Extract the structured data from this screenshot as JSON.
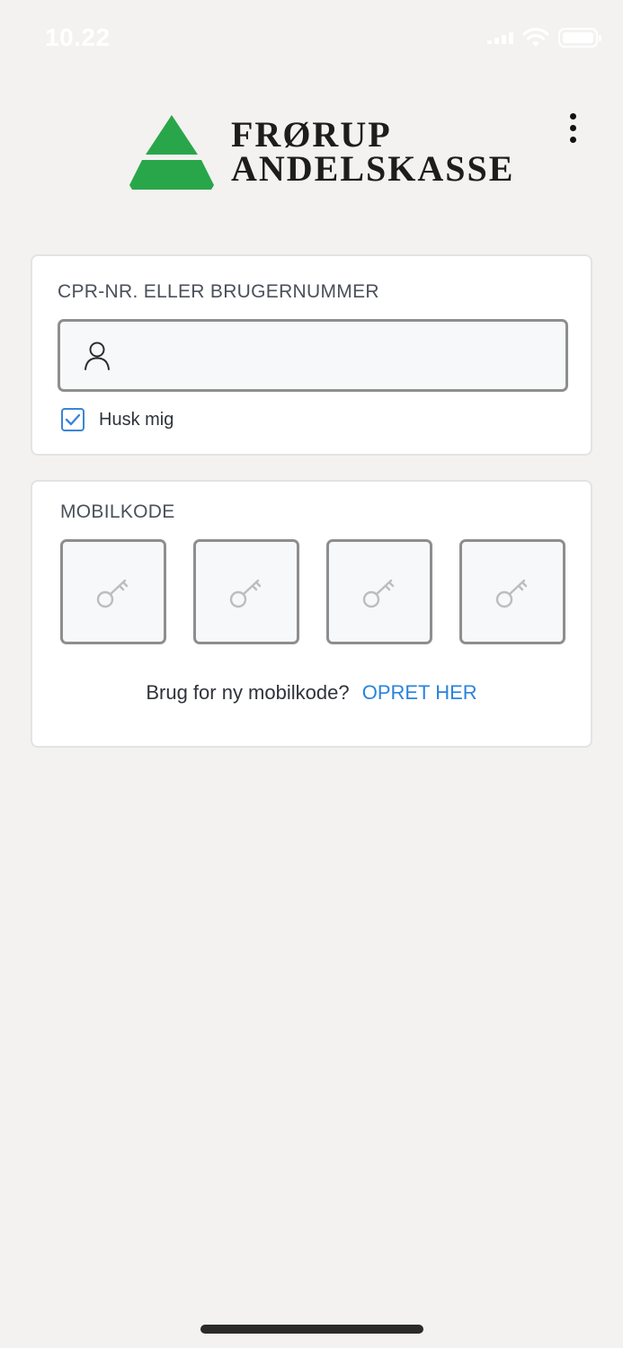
{
  "status_bar": {
    "time": "10.22"
  },
  "header": {
    "logo_line1": "FRØRUP",
    "logo_line2": "ANDELSKASSE"
  },
  "login": {
    "cpr_label": "CPR-NR. ELLER BRUGERNUMMER",
    "cpr_value": "",
    "remember_label": "Husk mig",
    "remember_checked": true
  },
  "mobile_code": {
    "label": "MOBILKODE",
    "digits": [
      "",
      "",
      "",
      ""
    ],
    "help_text": "Brug for ny mobilkode?",
    "create_link": "OPRET HER"
  },
  "colors": {
    "accent": "#2a83dc",
    "logo_green": "#2aa64a",
    "background": "#f3f2f0"
  }
}
